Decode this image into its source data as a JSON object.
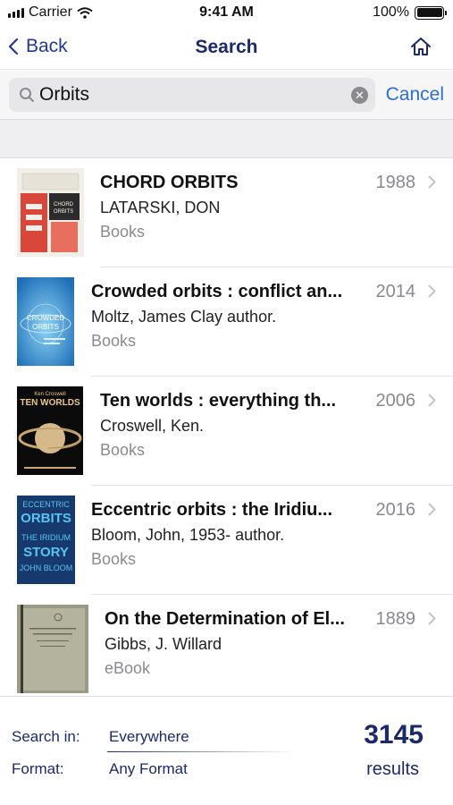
{
  "status_bar": {
    "carrier": "Carrier",
    "time": "9:41 AM",
    "battery": "100%"
  },
  "nav": {
    "back_label": "Back",
    "title": "Search",
    "home_icon": "home-icon"
  },
  "search": {
    "value": "Orbits",
    "cancel_label": "Cancel"
  },
  "results": [
    {
      "title": "CHORD ORBITS",
      "year": "1988",
      "author": "LATARSKI, DON",
      "format": "Books",
      "cover": {
        "text": "CHORD ORBITS",
        "bg": "#f2f0eb",
        "accent": "#d9463a"
      }
    },
    {
      "title": "Crowded orbits : conflict an...",
      "year": "2014",
      "author": "Moltz, James Clay author.",
      "format": "Books",
      "cover": {
        "text": "CROWDED ORBITS",
        "bg": "#1e6fb8",
        "accent": "#8fd4f5"
      }
    },
    {
      "title": "Ten worlds : everything th...",
      "year": "2006",
      "author": "Croswell, Ken.",
      "format": "Books",
      "cover": {
        "text": "TEN WORLDS",
        "bg": "#0b0b0b",
        "accent": "#e8c98a"
      }
    },
    {
      "title": "Eccentric orbits : the Iridiu...",
      "year": "2016",
      "author": "Bloom, John, 1953- author.",
      "format": "Books",
      "cover": {
        "text": "ECCENTRIC ORBITS THE IRIDIUM STORY JOHN BLOOM",
        "bg": "#163a6e",
        "accent": "#5cc2f2"
      }
    },
    {
      "title": "On the Determination of El...",
      "year": "1889",
      "author": "Gibbs, J. Willard",
      "format": "eBook",
      "cover": {
        "text": "",
        "bg": "#9a9b86",
        "accent": "#3b3a2e"
      }
    }
  ],
  "footer": {
    "search_in_label": "Search in:",
    "search_in_value": "Everywhere",
    "format_label": "Format:",
    "format_value": "Any Format",
    "count": "3145",
    "count_label": "results"
  },
  "colors": {
    "navy": "#1b2a6b",
    "link_blue": "#2b6ed6",
    "gray_text": "#8a8a8e"
  }
}
